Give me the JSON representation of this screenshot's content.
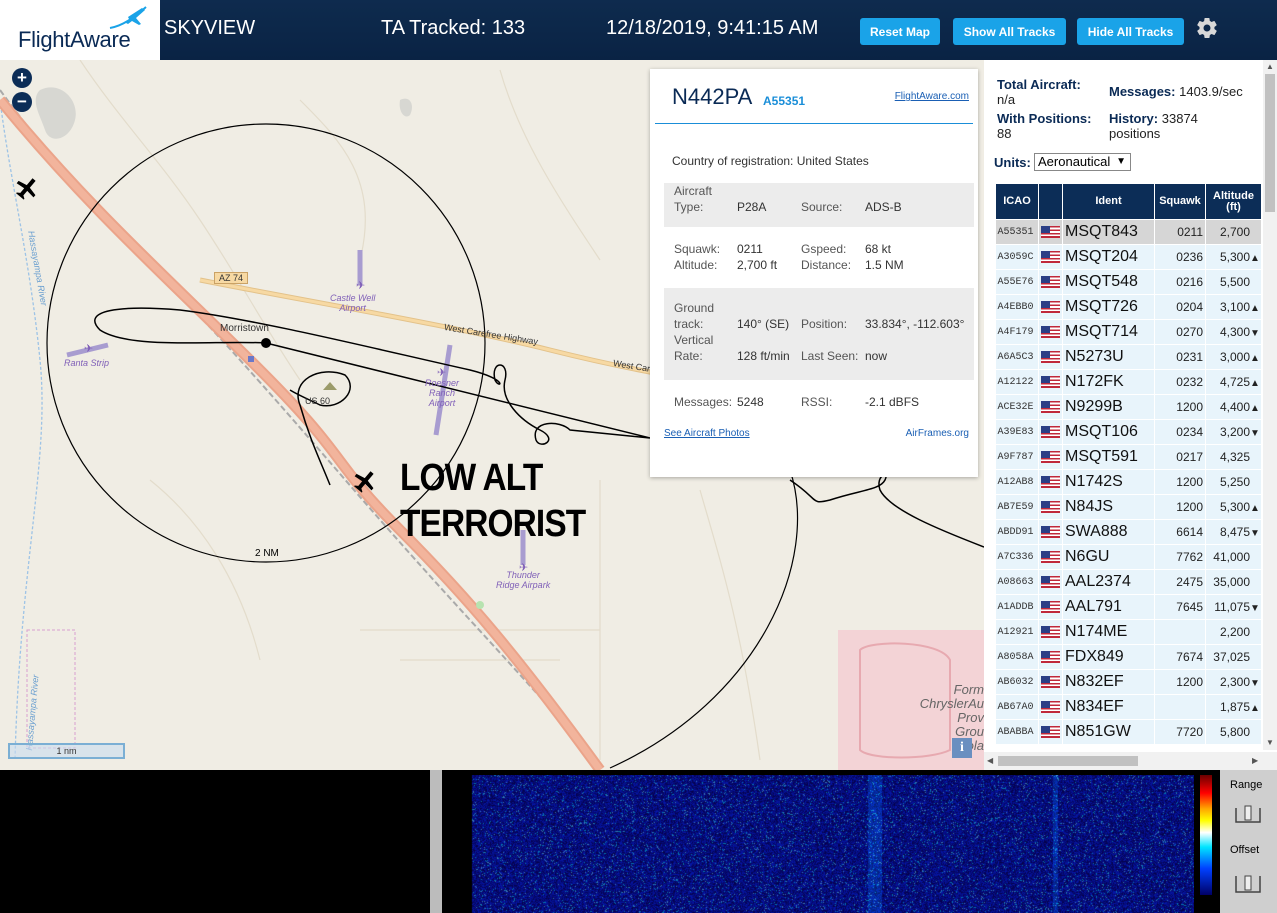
{
  "header": {
    "logo_text": "FlightAware",
    "app_name": "SKYVIEW",
    "ta_tracked": "TA Tracked: 133",
    "datetime": "12/18/2019, 9:41:15 AM",
    "buttons": {
      "reset": "Reset Map",
      "show_all": "Show All Tracks",
      "hide_all": "Hide All Tracks"
    },
    "settings_icon": "gear-icon"
  },
  "map": {
    "overlay_line1": "LOW ALT",
    "overlay_line2": "TERRORIST",
    "range_ring_label": "2 NM",
    "scale_label": "1 nm",
    "place_labels": {
      "morristown": "Morristown",
      "castle_well": "Castle Well\nAirport",
      "ranta": "Ranta Strip",
      "roesner": "Roesner\nRanch\nAirport",
      "thunder_ridge": "Thunder\nRidge Airpark",
      "az74": "AZ 74",
      "us60": "US 60",
      "carefree": "West Carefree Highway",
      "carefree2": "West Care",
      "river": "Hassayampa River",
      "river2": "Hassayampa River",
      "chrysler": "Form\nChryslerAu\nProv\nGrou\nSola"
    },
    "zoom_in": "+",
    "zoom_out": "−",
    "info": "i"
  },
  "popup": {
    "ident": "N442PA",
    "icao": "A55351",
    "link_flightaware": "FlightAware.com",
    "country_label": "Country of registration:",
    "country_value": "United States",
    "aircraft_type_label": "Aircraft\nType:",
    "aircraft_type_value": "P28A",
    "source_label": "Source:",
    "source_value": "ADS-B",
    "squawk_label": "Squawk:",
    "squawk_value": "0211",
    "altitude_label": "Altitude:",
    "altitude_value": "2,700 ft",
    "gspeed_label": "Gspeed:",
    "gspeed_value": "68 kt",
    "distance_label": "Distance:",
    "distance_value": "1.5 NM",
    "ground_track_label": "Ground\ntrack:",
    "ground_track_value": "140° (SE)",
    "vertical_rate_label": "Vertical\nRate:",
    "vertical_rate_value": "128 ft/min",
    "position_label": "Position:",
    "position_value": "33.834°, -112.603°",
    "last_seen_label": "Last Seen:",
    "last_seen_value": "now",
    "messages_label": "Messages:",
    "messages_value": "5248",
    "rssi_label": "RSSI:",
    "rssi_value": "-2.1 dBFS",
    "link_photos": "See Aircraft Photos",
    "link_airframes": "AirFrames.org"
  },
  "panel": {
    "total_aircraft_label": "Total Aircraft:",
    "total_aircraft_value": "n/a",
    "messages_label": "Messages:",
    "messages_value": "1403.9/sec",
    "with_positions_label": "With Positions:",
    "with_positions_value": "88",
    "history_label": "History:",
    "history_value": "33874",
    "history_unit": "positions",
    "units_label": "Units:",
    "units_value": "Aeronautical",
    "table_headers": {
      "icao": "ICAO",
      "ident": "Ident",
      "squawk": "Squawk",
      "altitude": "Altitude\n(ft)"
    },
    "rows": [
      {
        "icao": "A55351",
        "ident": "MSQT843",
        "squawk": "0211",
        "altitude": "2,700",
        "trend": "",
        "selected": true
      },
      {
        "icao": "A3059C",
        "ident": "MSQT204",
        "squawk": "0236",
        "altitude": "5,300",
        "trend": "▲"
      },
      {
        "icao": "A55E76",
        "ident": "MSQT548",
        "squawk": "0216",
        "altitude": "5,500",
        "trend": ""
      },
      {
        "icao": "A4EBB0",
        "ident": "MSQT726",
        "squawk": "0204",
        "altitude": "3,100",
        "trend": "▲"
      },
      {
        "icao": "A4F179",
        "ident": "MSQT714",
        "squawk": "0270",
        "altitude": "4,300",
        "trend": "▼"
      },
      {
        "icao": "A6A5C3",
        "ident": "N5273U",
        "squawk": "0231",
        "altitude": "3,000",
        "trend": "▲"
      },
      {
        "icao": "A12122",
        "ident": "N172FK",
        "squawk": "0232",
        "altitude": "4,725",
        "trend": "▲"
      },
      {
        "icao": "ACE32E",
        "ident": "N9299B",
        "squawk": "1200",
        "altitude": "4,400",
        "trend": "▲"
      },
      {
        "icao": "A39E83",
        "ident": "MSQT106",
        "squawk": "0234",
        "altitude": "3,200",
        "trend": "▼"
      },
      {
        "icao": "A9F787",
        "ident": "MSQT591",
        "squawk": "0217",
        "altitude": "4,325",
        "trend": ""
      },
      {
        "icao": "A12AB8",
        "ident": "N1742S",
        "squawk": "1200",
        "altitude": "5,250",
        "trend": ""
      },
      {
        "icao": "AB7E59",
        "ident": "N84JS",
        "squawk": "1200",
        "altitude": "5,300",
        "trend": "▲"
      },
      {
        "icao": "ABDD91",
        "ident": "SWA888",
        "squawk": "6614",
        "altitude": "8,475",
        "trend": "▼"
      },
      {
        "icao": "A7C336",
        "ident": "N6GU",
        "squawk": "7762",
        "altitude": "41,000",
        "trend": ""
      },
      {
        "icao": "A08663",
        "ident": "AAL2374",
        "squawk": "2475",
        "altitude": "35,000",
        "trend": ""
      },
      {
        "icao": "A1ADDB",
        "ident": "AAL791",
        "squawk": "7645",
        "altitude": "11,075",
        "trend": "▼"
      },
      {
        "icao": "A12921",
        "ident": "N174ME",
        "squawk": "",
        "altitude": "2,200",
        "trend": ""
      },
      {
        "icao": "A8058A",
        "ident": "FDX849",
        "squawk": "7674",
        "altitude": "37,025",
        "trend": ""
      },
      {
        "icao": "AB6032",
        "ident": "N832EF",
        "squawk": "1200",
        "altitude": "2,300",
        "trend": "▼"
      },
      {
        "icao": "AB67A0",
        "ident": "N834EF",
        "squawk": "",
        "altitude": "1,875",
        "trend": "▲"
      },
      {
        "icao": "ABABBA",
        "ident": "N851GW",
        "squawk": "7720",
        "altitude": "5,800",
        "trend": ""
      }
    ]
  },
  "waterfall": {
    "range_label": "Range",
    "offset_label": "Offset"
  }
}
